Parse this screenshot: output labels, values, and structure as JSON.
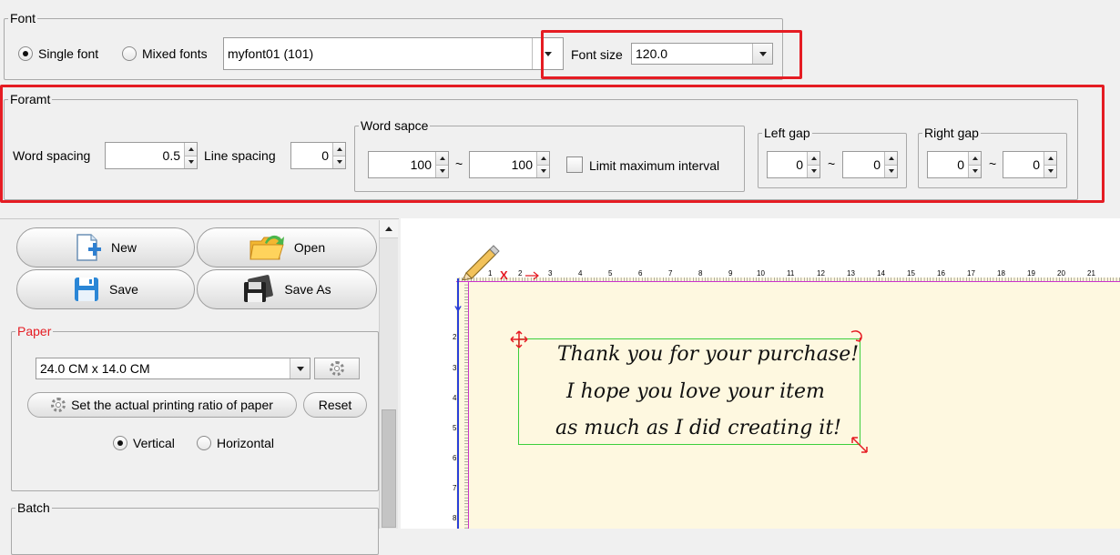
{
  "font_group": {
    "legend": "Font",
    "single_font_label": "Single font",
    "mixed_fonts_label": "Mixed fonts",
    "selected_mode": "single",
    "font_value": "myfont01 (101)",
    "font_size_label": "Font size",
    "font_size_value": "120.0"
  },
  "format_group": {
    "legend": "Foramt",
    "word_spacing_label": "Word spacing",
    "word_spacing_value": "0.5",
    "line_spacing_label": "Line spacing",
    "line_spacing_value": "0",
    "word_space": {
      "legend": "Word sapce",
      "min": "100",
      "sep": "~",
      "max": "100",
      "limit_label": "Limit maximum interval",
      "limit_checked": false
    },
    "left_gap": {
      "legend": "Left gap",
      "min": "0",
      "sep": "~",
      "max": "0"
    },
    "right_gap": {
      "legend": "Right gap",
      "min": "0",
      "sep": "~",
      "max": "0"
    }
  },
  "toolbar": {
    "new_label": "New",
    "open_label": "Open",
    "save_label": "Save",
    "save_as_label": "Save As"
  },
  "paper_group": {
    "legend": "Paper",
    "size_value": "24.0 CM x 14.0 CM",
    "ratio_button_label": "Set the actual printing ratio of paper",
    "reset_label": "Reset",
    "vertical_label": "Vertical",
    "horizontal_label": "Horizontal",
    "orientation": "vertical"
  },
  "batch_group": {
    "legend": "Batch"
  },
  "ruler": {
    "top_ticks": [
      "1",
      "2",
      "3",
      "4",
      "5",
      "6",
      "7",
      "8",
      "9",
      "10",
      "11",
      "12",
      "13",
      "14",
      "15",
      "16",
      "17",
      "18",
      "19",
      "20",
      "21"
    ],
    "left_ticks": [
      "2",
      "3",
      "4",
      "5",
      "6",
      "7",
      "8"
    ],
    "x_marker": "X",
    "y_marker": "Y"
  },
  "canvas_text": {
    "lines": [
      "Thank you for your purchase!",
      "I hope you love your item",
      "as much as I did creating it!"
    ]
  },
  "colors": {
    "highlight": "#e51c23",
    "paper": "#fef8e0",
    "selection": "#3ccf3c",
    "ruler_magenta": "#cc33cc",
    "axis_blue": "#2a3fd8"
  }
}
